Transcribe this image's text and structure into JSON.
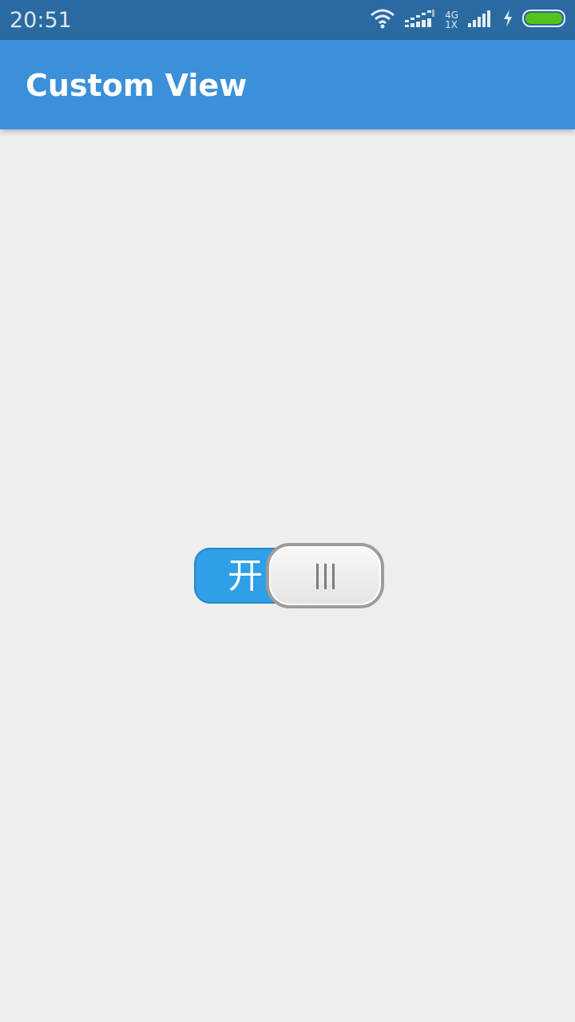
{
  "status_bar": {
    "time": "20:51",
    "icons": [
      "wifi-icon",
      "data-signal-icon",
      "cell-signal-icon",
      "charging-icon",
      "battery-icon"
    ],
    "network_top": "4G",
    "network_bottom": "1X",
    "battery_color": "#52c41a"
  },
  "app_bar": {
    "title": "Custom View",
    "color": "#3b90d9"
  },
  "toggle": {
    "label": "开",
    "state": "on",
    "track_color": "#2f9fe8"
  }
}
